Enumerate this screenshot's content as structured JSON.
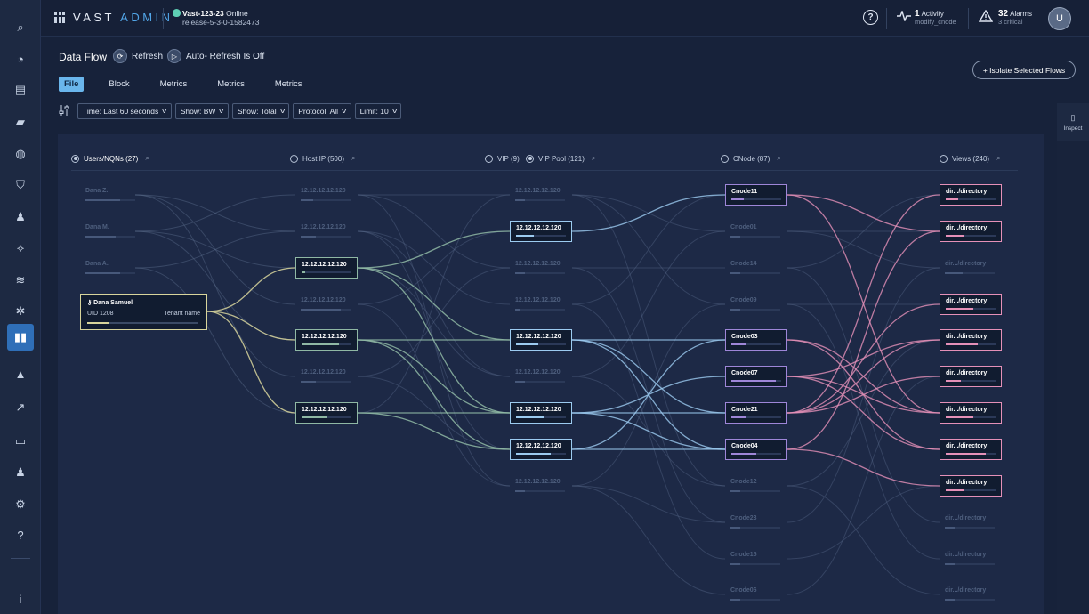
{
  "header": {
    "brand_left": "VAST",
    "brand_right": "ADMIN",
    "cluster_name": "Vast-123-23",
    "cluster_status": "Online",
    "release": "release-5-3-0-1582473",
    "help_label": "?",
    "activity": {
      "count": "1",
      "label": "Activity",
      "sub": "modify_cnode"
    },
    "alarms": {
      "count": "32",
      "label": "Alarms",
      "sub": "3 critical"
    },
    "avatar_initial": "U"
  },
  "sidebar": {
    "items": [
      {
        "icon": "search-icon",
        "glyph": "⌕"
      },
      {
        "icon": "dashboard-icon",
        "glyph": "◔"
      },
      {
        "icon": "servers-icon",
        "glyph": "▤"
      },
      {
        "icon": "folders-icon",
        "glyph": "▰"
      },
      {
        "icon": "globe-icon",
        "glyph": "◍"
      },
      {
        "icon": "shield-icon",
        "glyph": "⛉"
      },
      {
        "icon": "users-icon",
        "glyph": "♟"
      },
      {
        "icon": "network-icon",
        "glyph": "⟡"
      },
      {
        "icon": "database-icon",
        "glyph": "≋"
      },
      {
        "icon": "settings-list-icon",
        "glyph": "✲"
      },
      {
        "icon": "analytics-icon",
        "glyph": "▮▮",
        "active": true
      },
      {
        "icon": "alert-icon",
        "glyph": "▲"
      },
      {
        "icon": "trend-icon",
        "glyph": "↗"
      },
      {
        "icon": "drive-icon",
        "glyph": "▭"
      },
      {
        "icon": "user-settings-icon",
        "glyph": "♟"
      },
      {
        "icon": "gear-icon",
        "glyph": "⚙"
      },
      {
        "icon": "help-icon",
        "glyph": "?"
      },
      {
        "icon": "info-icon",
        "glyph": "i"
      }
    ]
  },
  "toolbar": {
    "title": "Data Flow",
    "refresh_label": "Refresh",
    "autorefresh_label": "Auto- Refresh Is Off",
    "isolate_label": "+ Isolate Selected Flows"
  },
  "tabs": [
    {
      "label": "File",
      "active": true
    },
    {
      "label": "Block"
    },
    {
      "label": "Metrics"
    },
    {
      "label": "Metrics"
    },
    {
      "label": "Metrics"
    }
  ],
  "filters": [
    {
      "label": "Time: Last 60 seconds"
    },
    {
      "label": "Show: BW"
    },
    {
      "label": "Show: Total"
    },
    {
      "label": "Protocol: All"
    },
    {
      "label": "Limit: 10"
    }
  ],
  "inspect_label": "Inspect",
  "columns": {
    "users": "Users/NQNs (27)",
    "hostip": "Host IP (500)",
    "vip": "VIP (9)",
    "vippool": "VIP Pool (121)",
    "cnode": "CNode (87)",
    "views": "Views (240)"
  },
  "selected_user": {
    "name": "Dana Samuel",
    "uid": "UID 1208",
    "tenant": "Tenant name",
    "usage": 0.2
  },
  "nodes": {
    "users": [
      {
        "label": "Dana Z.",
        "fill": 0.7
      },
      {
        "label": "Dana M.",
        "fill": 0.6
      },
      {
        "label": "Dana A.",
        "fill": 0.7
      }
    ],
    "hostip": [
      {
        "label": "12.12.12.12.120",
        "fill": 0.25
      },
      {
        "label": "12.12.12.12.120",
        "fill": 0.3
      },
      {
        "label": "12.12.12.12.120",
        "fill": 0.08,
        "hi": true
      },
      {
        "label": "12.12.12.12.120",
        "fill": 0.8
      },
      {
        "label": "12.12.12.12.120",
        "fill": 0.75,
        "hi": true
      },
      {
        "label": "12.12.12.12.120",
        "fill": 0.3
      },
      {
        "label": "12.12.12.12.120",
        "fill": 0.5,
        "hi": true
      }
    ],
    "vippool": [
      {
        "label": "12.12.12.12.120",
        "fill": 0.2
      },
      {
        "label": "12.12.12.12.120",
        "fill": 0.35,
        "hi": true
      },
      {
        "label": "12.12.12.12.120",
        "fill": 0.2
      },
      {
        "label": "12.12.12.12.120",
        "fill": 0.1
      },
      {
        "label": "12.12.12.12.120",
        "fill": 0.45,
        "hi": true
      },
      {
        "label": "12.12.12.12.120",
        "fill": 0.2
      },
      {
        "label": "12.12.12.12.120",
        "fill": 0.55,
        "hi": true
      },
      {
        "label": "12.12.12.12.120",
        "fill": 0.7,
        "hi": true
      },
      {
        "label": "12.12.12.12.120",
        "fill": 0.2
      }
    ],
    "cnode": [
      {
        "label": "Cnode11",
        "fill": 0.25,
        "hi": true
      },
      {
        "label": "Cnode01",
        "fill": 0.2
      },
      {
        "label": "Cnode14",
        "fill": 0.2
      },
      {
        "label": "Cnode09",
        "fill": 0.2
      },
      {
        "label": "Cnode03",
        "fill": 0.3,
        "hi": true
      },
      {
        "label": "Cnode07",
        "fill": 0.9,
        "hi": true
      },
      {
        "label": "Cnode21",
        "fill": 0.3,
        "hi": true
      },
      {
        "label": "Cnode04",
        "fill": 0.5,
        "hi": true
      },
      {
        "label": "Cnode12",
        "fill": 0.2
      },
      {
        "label": "Cnode23",
        "fill": 0.2
      },
      {
        "label": "Cnode15",
        "fill": 0.2
      },
      {
        "label": "Cnode06",
        "fill": 0.2
      }
    ],
    "views": [
      {
        "label": "dir.../directory",
        "fill": 0.25,
        "hi": true
      },
      {
        "label": "dir.../directory",
        "fill": 0.35,
        "hi": true
      },
      {
        "label": "dir.../directory",
        "fill": 0.35
      },
      {
        "label": "dir.../directory",
        "fill": 0.55,
        "hi": true
      },
      {
        "label": "dir.../directory",
        "fill": 0.65,
        "hi": true
      },
      {
        "label": "dir.../directory",
        "fill": 0.3,
        "hi": true
      },
      {
        "label": "dir.../directory",
        "fill": 0.55,
        "hi": true
      },
      {
        "label": "dir.../directory",
        "fill": 0.8,
        "hi": true
      },
      {
        "label": "dir.../directory",
        "fill": 0.35,
        "hi": true
      },
      {
        "label": "dir.../directory",
        "fill": 0.2
      },
      {
        "label": "dir.../directory",
        "fill": 0.2
      },
      {
        "label": "dir.../directory",
        "fill": 0.2
      }
    ]
  },
  "colors": {
    "accent": "#6ab6ec",
    "user": "#d8d59c",
    "host": "#8fb8a4",
    "vip": "#9ccbf0",
    "cnode": "#9e86d8",
    "view": "#e590b8"
  }
}
